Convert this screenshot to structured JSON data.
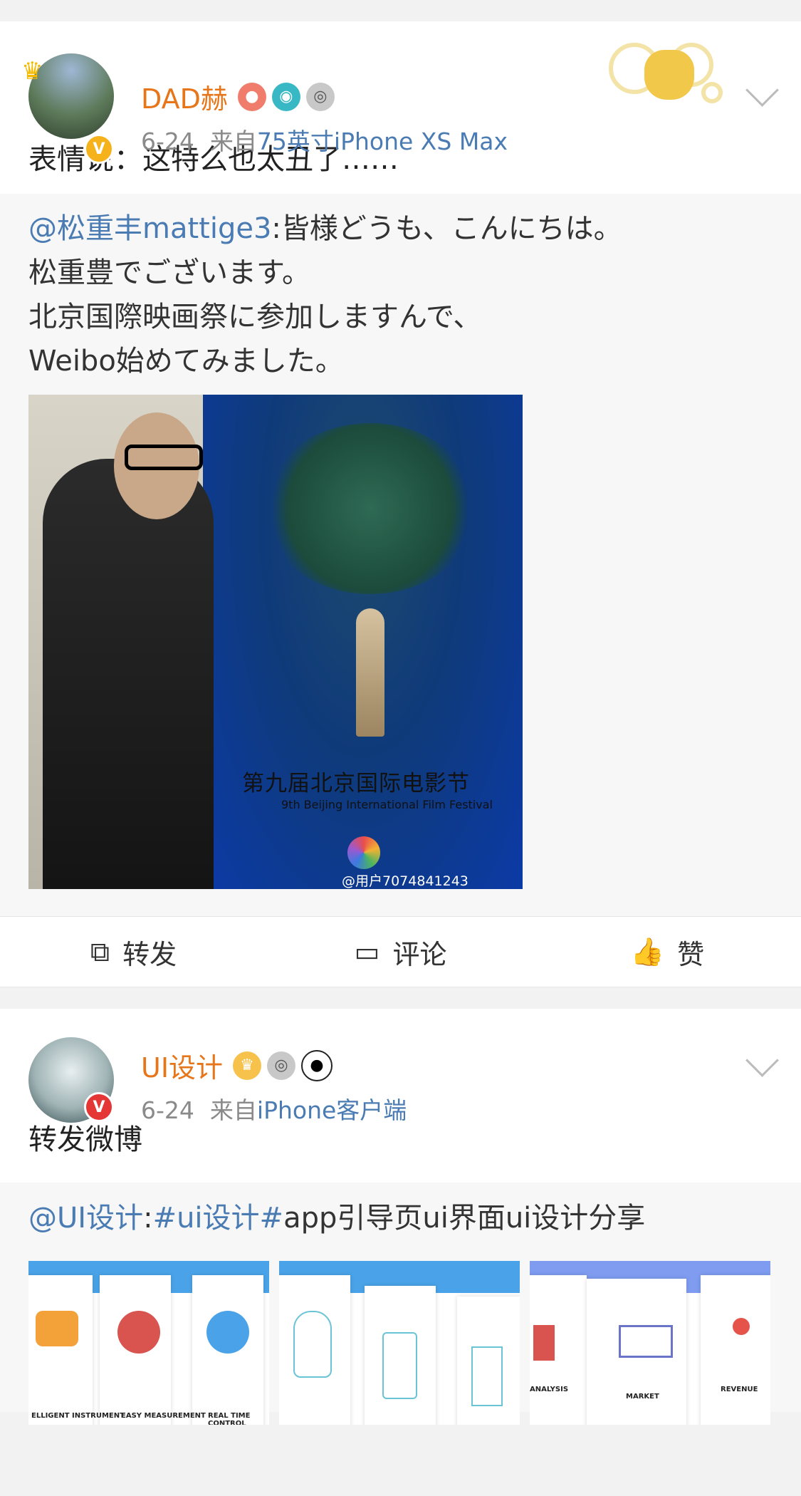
{
  "post1": {
    "username": "DAD赫",
    "date": "6-24",
    "source_prefix": "来自",
    "source": "75英寸iPhone XS Max",
    "text": "表情说：这特么也太丑了……",
    "badge_letter": "V",
    "repost": {
      "mention": "@松重丰mattige3",
      "line1_rest": ":皆様どうも、こんにちは。",
      "line2": "松重豊でございます。",
      "line3": "北京国際映画祭に参加しますんで、",
      "line4": "Weibo始めてみました。",
      "image": {
        "poster_title_cn": "第九届北京国际电影节",
        "poster_title_en": "9th Beijing International Film Festival",
        "watermark": "@用户7074841243"
      }
    },
    "actions": {
      "repost": "转发",
      "comment": "评论",
      "like": "赞"
    }
  },
  "post2": {
    "username": "UI设计",
    "date": "6-24",
    "source_prefix": "来自",
    "source": "iPhone客户端",
    "text": "转发微博",
    "badge_letter": "V",
    "repost": {
      "mention": "@UI设计",
      "colon": ":",
      "hashtag": "#ui设计#",
      "rest": "app引导页ui界面ui设计分享",
      "thumbs": [
        {
          "labels": [
            "ELLIGENT INSTRUMENT",
            "EASY MEASUREMENT",
            "REAL TIME CONTROL"
          ]
        },
        {
          "labels": []
        },
        {
          "labels": [
            "ANALYSIS",
            "MARKET",
            "REVENUE"
          ]
        }
      ]
    }
  },
  "icons": {
    "chevron": "chevron-down-icon",
    "repost": "share-icon",
    "comment": "comment-icon",
    "like": "thumbs-up-icon"
  },
  "colors": {
    "username": "#e7761a",
    "link": "#4a7bb3",
    "meta": "#8a8a8a"
  }
}
